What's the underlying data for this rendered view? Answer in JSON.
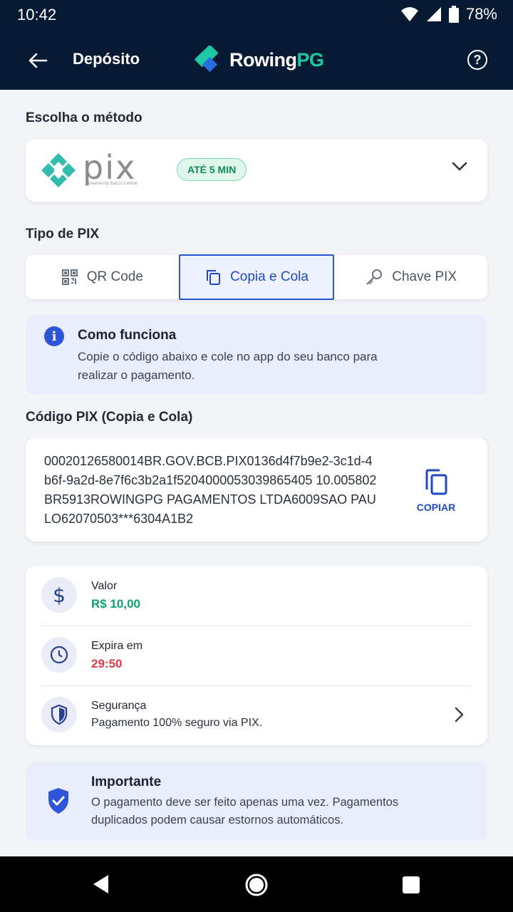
{
  "status_bar": {
    "time": "10:42",
    "battery": "78%"
  },
  "header": {
    "title": "Depósito",
    "brand_main": "Rowing",
    "brand_accent": "PG"
  },
  "method": {
    "section_label": "Escolha o método",
    "logo_text": "pix",
    "logo_sub": "powered by Banco Central",
    "badge": "ATÉ 5 MIN"
  },
  "pix_type": {
    "section_label": "Tipo de PIX",
    "tabs": [
      {
        "label": "QR Code",
        "active": false
      },
      {
        "label": "Copia e Cola",
        "active": true
      },
      {
        "label": "Chave PIX",
        "active": false
      }
    ]
  },
  "info": {
    "title": "Como funciona",
    "text": "Copie o código abaixo e cole no app do seu banco para realizar o pagamento."
  },
  "code": {
    "section_label": "Código PIX (Copia e Cola)",
    "value": "00020126580014BR.GOV.BCB.PIX0136d4f7b9e2-3c1d-4b6f-9a2d-8e7f6c3b2a1f5204000053039865405 10.005802BR5913ROWINGPG PAGAMENTOS LTDA6009SAO PAULO62070503***6304A1B2",
    "copy_label": "COPIAR"
  },
  "details": {
    "amount_label": "Valor",
    "amount_value": "R$ 10,00",
    "expires_label": "Expira em",
    "expires_value": "29:50",
    "security_label": "Segurança",
    "security_value": "Pagamento 100% seguro via PIX."
  },
  "important": {
    "title": "Importante",
    "text": "O pagamento deve ser feito apenas uma vez. Pagamentos duplicados podem causar estornos automáticos."
  },
  "colors": {
    "header_bg": "#071a33",
    "accent_blue": "#1f49c9",
    "accent_green": "#0fa36b",
    "timer_red": "#e53945",
    "pix_teal": "#32bcad"
  }
}
